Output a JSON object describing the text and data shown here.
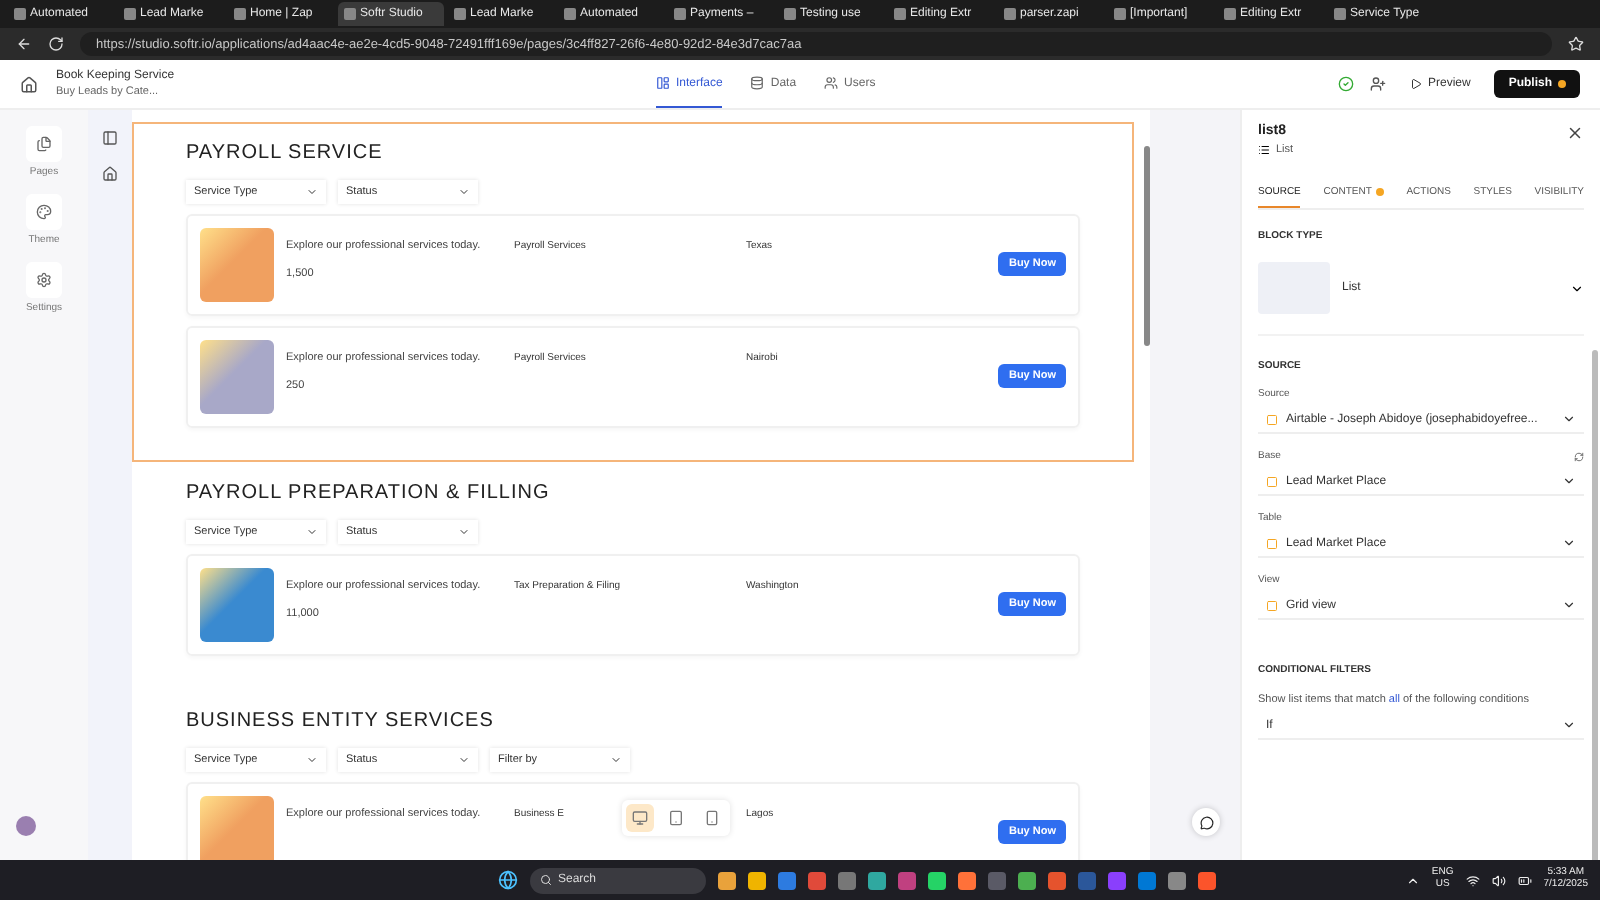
{
  "browser": {
    "tabs": [
      {
        "title": "Automated",
        "selected": false
      },
      {
        "title": "Lead Marke",
        "selected": false
      },
      {
        "title": "Home | Zap",
        "selected": false
      },
      {
        "title": "Softr Studio",
        "selected": true
      },
      {
        "title": "Lead Marke",
        "selected": false
      },
      {
        "title": "Automated",
        "selected": false
      },
      {
        "title": "Payments –",
        "selected": false
      },
      {
        "title": "Testing use",
        "selected": false
      },
      {
        "title": "Editing Extr",
        "selected": false
      },
      {
        "title": "parser.zapi",
        "selected": false
      },
      {
        "title": "[Important]",
        "selected": false
      },
      {
        "title": "Editing Extr",
        "selected": false
      },
      {
        "title": "Service Type",
        "selected": false
      }
    ],
    "url": "https://studio.softr.io/applications/ad4aac4e-ae2e-4cd5-9048-72491fff169e/pages/3c4ff827-26f6-4e80-92d2-84e3d7cac7aa"
  },
  "header": {
    "project": "Book Keeping Service",
    "page": "Buy Leads by Cate...",
    "nav": [
      {
        "label": "Interface",
        "kind": "interface",
        "selected": true
      },
      {
        "label": "Data",
        "kind": "data",
        "selected": false
      },
      {
        "label": "Users",
        "kind": "users",
        "selected": false
      }
    ],
    "preview": "Preview",
    "publish": "Publish"
  },
  "rail": [
    {
      "label": "Pages",
      "kind": "pages"
    },
    {
      "label": "Theme",
      "kind": "theme"
    },
    {
      "label": "Settings",
      "kind": "settings"
    }
  ],
  "sections": [
    {
      "title": "PAYROLL SERVICE",
      "selected": true,
      "filters": [
        "Service Type",
        "Status"
      ],
      "items": [
        {
          "description": "Explore our professional services today.",
          "price": "1,500",
          "category": "Payroll Services",
          "location": "Texas",
          "button": "Buy Now",
          "color": "#f0a060"
        },
        {
          "description": "Explore our professional services today.",
          "price": "250",
          "category": "Payroll Services",
          "location": "Nairobi",
          "button": "Buy Now",
          "color": "#a8a8c8"
        }
      ]
    },
    {
      "title": "PAYROLL PREPARATION & FILLING",
      "selected": false,
      "filters": [
        "Service Type",
        "Status"
      ],
      "items": [
        {
          "description": "Explore our professional services today.",
          "price": "11,000",
          "category": "Tax Preparation & Filing",
          "location": "Washington",
          "button": "Buy Now",
          "color": "#3a8ad0"
        }
      ]
    },
    {
      "title": "BUSINESS ENTITY SERVICES",
      "selected": false,
      "filters": [
        "Service Type",
        "Status",
        "Filter by"
      ],
      "items": [
        {
          "description": "Explore our professional services today.",
          "category": "Business E",
          "location": "Lagos",
          "button": "Buy Now",
          "color": "#f0a060"
        }
      ]
    }
  ],
  "devices": [
    {
      "kind": "desktop",
      "selected": true
    },
    {
      "kind": "tablet",
      "selected": false
    },
    {
      "kind": "mobile",
      "selected": false
    }
  ],
  "panel": {
    "title": "list8",
    "subtitle": "List",
    "tabs": [
      {
        "label": "SOURCE",
        "selected": true,
        "alert": false
      },
      {
        "label": "CONTENT",
        "selected": false,
        "alert": true
      },
      {
        "label": "ACTIONS",
        "selected": false,
        "alert": false
      },
      {
        "label": "STYLES",
        "selected": false,
        "alert": false
      },
      {
        "label": "VISIBILITY",
        "selected": false,
        "alert": false
      }
    ],
    "block_type_heading": "BLOCK TYPE",
    "block_type": "List",
    "source_heading": "SOURCE",
    "fields": [
      {
        "label": "Source",
        "value": "Airtable - Joseph Abidoye (josephabidoyefree..."
      },
      {
        "label": "Base",
        "value": "Lead Market Place"
      },
      {
        "label": "Table",
        "value": "Lead Market Place"
      },
      {
        "label": "View",
        "value": "Grid view"
      }
    ],
    "filters_heading": "CONDITIONAL FILTERS",
    "filters_before": "Show list items that match",
    "filters_match": "all",
    "filters_after": "of the following conditions",
    "condition": "If"
  },
  "taskbar": {
    "search": "Search",
    "language": "ENG",
    "region": "US",
    "time": "5:33 AM",
    "date": "7/12/2025"
  }
}
